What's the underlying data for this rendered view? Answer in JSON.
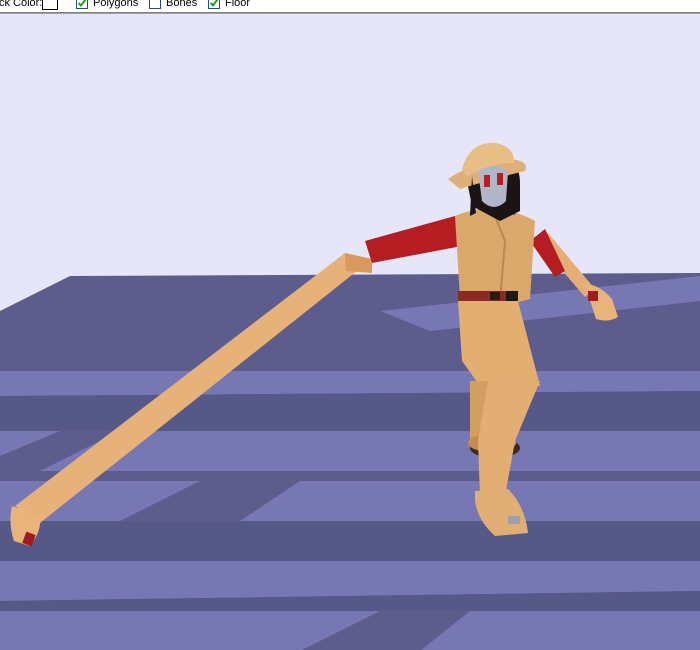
{
  "toolbar": {
    "back_color_label": "ck Color:",
    "polygons_label": "Polygons",
    "bones_label": "Bones",
    "floor_label": "Floor"
  },
  "checkboxes": {
    "polygons": true,
    "bones": false,
    "floor": true
  },
  "colors": {
    "sky": "#e6e6f8",
    "floor_dark": "#5a5c8a",
    "floor_light": "#7676b2",
    "skin": "#e8b57a",
    "outfit": "#d8a868",
    "sleeve": "#b71e22",
    "hair": "#1a1414"
  },
  "icons": {
    "checkmark": "check-icon"
  }
}
